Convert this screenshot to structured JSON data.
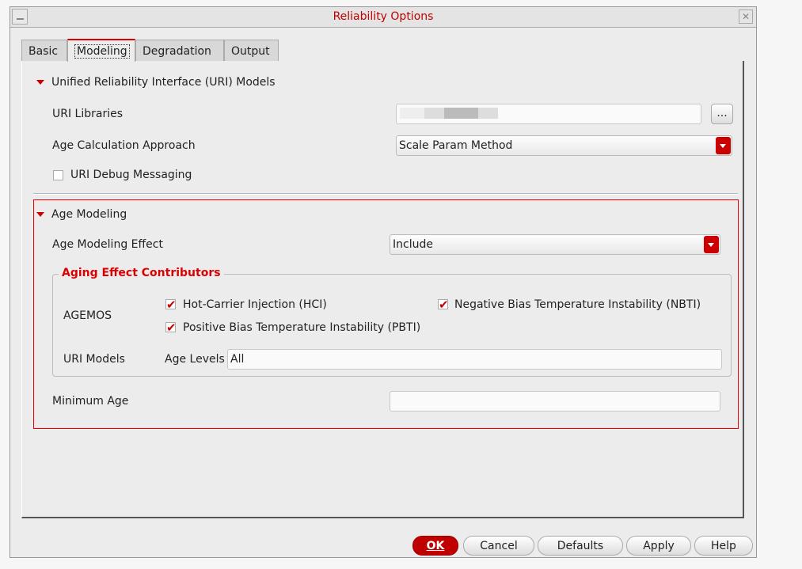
{
  "window": {
    "title": "Reliability Options",
    "close": "✕"
  },
  "tabs": [
    {
      "label": "Basic"
    },
    {
      "label": "Modeling"
    },
    {
      "label": "Degradation"
    },
    {
      "label": "Output"
    }
  ],
  "uri": {
    "section": "Unified Reliability Interface (URI) Models",
    "libraries_label": "URI Libraries",
    "libraries_value": "",
    "browse": "...",
    "age_calc_label": "Age Calculation Approach",
    "age_calc_value": "Scale Param Method",
    "debug_label": "URI Debug Messaging"
  },
  "age": {
    "section": "Age Modeling",
    "effect_label": "Age Modeling Effect",
    "effect_value": "Include",
    "group_title": "Aging Effect Contributors",
    "agemos_label": "AGEMOS",
    "hci": "Hot-Carrier Injection (HCI)",
    "nbti": "Negative Bias Temperature Instability (NBTI)",
    "pbti": "Positive Bias Temperature Instability (PBTI)",
    "uri_models_label": "URI Models",
    "age_levels_label": "Age Levels",
    "age_levels_value": "All",
    "min_age_label": "Minimum Age",
    "min_age_value": ""
  },
  "buttons": {
    "ok": "OK",
    "cancel": "Cancel",
    "defaults": "Defaults",
    "apply": "Apply",
    "help": "Help"
  },
  "colors": {
    "accent": "#c00000"
  }
}
